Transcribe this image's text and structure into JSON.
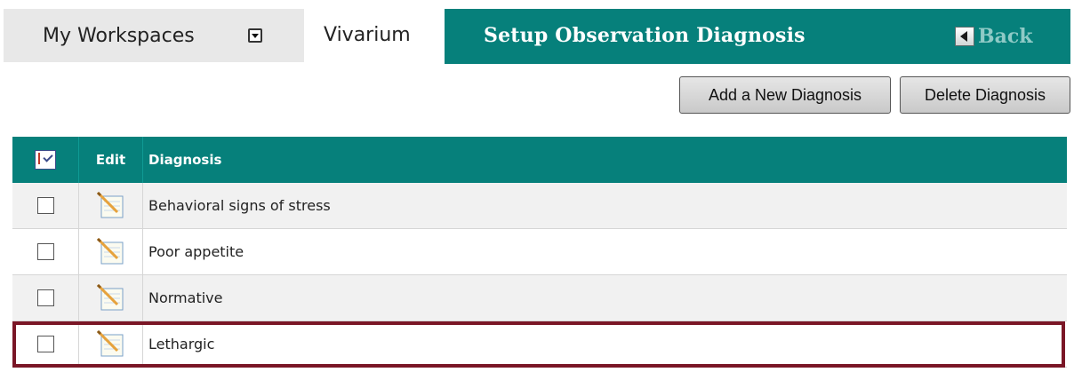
{
  "header": {
    "workspaces_label": "My Workspaces",
    "workspaces_dropdown_icon": "dropdown-arrow-icon",
    "module_label": "Vivarium",
    "page_title": "Setup Observation Diagnosis",
    "back_label": "Back",
    "back_icon": "left-arrow-icon"
  },
  "actions": {
    "add_label": "Add a New Diagnosis",
    "delete_label": "Delete Diagnosis"
  },
  "table": {
    "columns": {
      "select_icon": "check-sort-icon",
      "edit": "Edit",
      "diagnosis": "Diagnosis"
    },
    "rows": [
      {
        "diagnosis": "Behavioral signs of stress",
        "checked": false
      },
      {
        "diagnosis": "Poor appetite",
        "checked": false
      },
      {
        "diagnosis": "Normative",
        "checked": false
      },
      {
        "diagnosis": "Lethargic",
        "checked": false,
        "highlighted": true
      }
    ]
  },
  "colors": {
    "accent_teal": "#06807b",
    "highlight_border": "#7a1626",
    "tab_gray": "#e8e8e8"
  }
}
